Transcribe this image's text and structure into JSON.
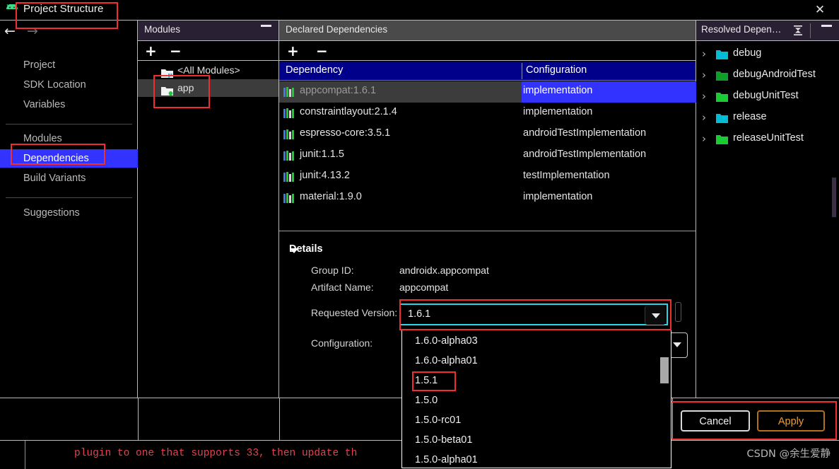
{
  "window": {
    "title": "Project Structure",
    "close_label": "✕",
    "app_icon": "android-icon"
  },
  "nav": {
    "back_icon": "←",
    "forward_icon": "→",
    "items": [
      {
        "label": "Project",
        "selected": false
      },
      {
        "label": "SDK Location",
        "selected": false
      },
      {
        "label": "Variables",
        "selected": false
      },
      {
        "label": "Modules",
        "selected": false
      },
      {
        "label": "Dependencies",
        "selected": true
      },
      {
        "label": "Build Variants",
        "selected": false
      },
      {
        "label": "Suggestions",
        "selected": false
      }
    ]
  },
  "modules_panel": {
    "title": "Modules",
    "add_label": "+",
    "remove_label": "−",
    "items": [
      {
        "label": "<All Modules>",
        "selected": false,
        "dot": false
      },
      {
        "label": "app",
        "selected": true,
        "dot": true
      }
    ]
  },
  "declared_panel": {
    "title": "Declared Dependencies",
    "add_label": "+",
    "remove_label": "−",
    "columns": {
      "dependency": "Dependency",
      "configuration": "Configuration"
    },
    "rows": [
      {
        "dependency": "appcompat:1.6.1",
        "configuration": "implementation",
        "selected": true
      },
      {
        "dependency": "constraintlayout:2.1.4",
        "configuration": "implementation",
        "selected": false
      },
      {
        "dependency": "espresso-core:3.5.1",
        "configuration": "androidTestImplementation",
        "selected": false
      },
      {
        "dependency": "junit:1.1.5",
        "configuration": "androidTestImplementation",
        "selected": false
      },
      {
        "dependency": "junit:4.13.2",
        "configuration": "testImplementation",
        "selected": false
      },
      {
        "dependency": "material:1.9.0",
        "configuration": "implementation",
        "selected": false
      }
    ]
  },
  "details": {
    "header": "Details",
    "group_id_label": "Group ID:",
    "group_id_value": "androidx.appcompat",
    "artifact_label": "Artifact Name:",
    "artifact_value": "appcompat",
    "requested_version_label": "Requested Version:",
    "requested_version_value": "1.6.1",
    "configuration_label": "Configuration:"
  },
  "version_dropdown": {
    "options": [
      "1.6.0-alpha03",
      "1.6.0-alpha01",
      "1.5.1",
      "1.5.0",
      "1.5.0-rc01",
      "1.5.0-beta01",
      "1.5.0-alpha01"
    ],
    "highlighted": "1.5.1"
  },
  "resolved_panel": {
    "title": "Resolved Depen…",
    "items": [
      {
        "label": "debug",
        "color": "#00bcd4"
      },
      {
        "label": "debugAndroidTest",
        "color": "#0e9e2a"
      },
      {
        "label": "debugUnitTest",
        "color": "#19cc33"
      },
      {
        "label": "release",
        "color": "#00bcd4"
      },
      {
        "label": "releaseUnitTest",
        "color": "#19cc33"
      }
    ]
  },
  "footer": {
    "cancel_label": "Cancel",
    "apply_label": "Apply"
  },
  "console": {
    "message": "plugin to one that supports 33, then update th"
  },
  "watermark": "CSDN @余生爱静",
  "colors": {
    "accent_blue": "#3333ff",
    "header_navy": "#00008b",
    "panel_purple": "#2a2033",
    "panel_grey": "#4a4a4a",
    "annotation_red": "#f22d2d",
    "focus_cyan": "#2ad5e8",
    "apply_orange": "#e89f3c",
    "error_red": "#e2444e"
  }
}
